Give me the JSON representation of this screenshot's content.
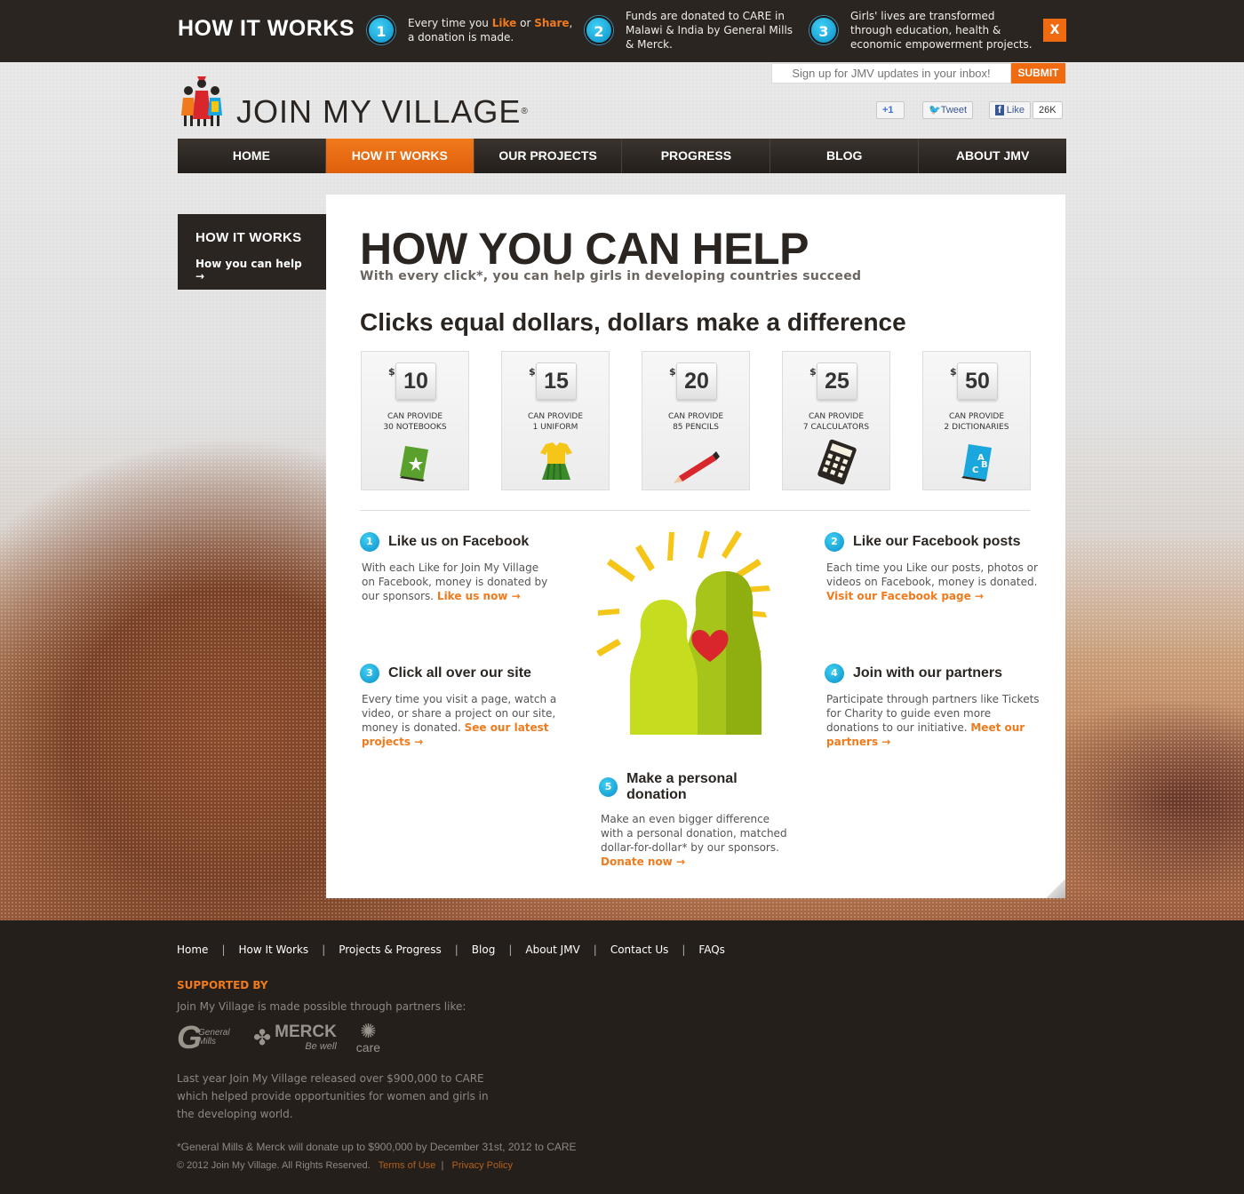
{
  "topbar": {
    "title": "HOW IT WORKS",
    "steps": [
      {
        "num": "1",
        "text_a": "Every time you ",
        "like": "Like",
        "text_b": " or ",
        "share": "Share",
        "text_c": ", a donation is made."
      },
      {
        "num": "2",
        "text": "Funds are donated to CARE in Malawi & India by General Mills & Merck."
      },
      {
        "num": "3",
        "text": "Girls' lives are transformed through education, health & economic empowerment projects."
      }
    ],
    "close_label": "X"
  },
  "header": {
    "signup_placeholder": "Sign up for JMV updates in your inbox!",
    "submit_label": "SUBMIT",
    "logo_text": "JOIN MY VILLAGE",
    "logo_reg": "®",
    "plusone": "+1",
    "tweet": "Tweet",
    "like": "Like",
    "like_count": "26K"
  },
  "nav": [
    "HOME",
    "HOW IT WORKS",
    "OUR PROJECTS",
    "PROGRESS",
    "BLOG",
    "ABOUT JMV"
  ],
  "sidebar": {
    "heading": "HOW IT WORKS",
    "link": "How you can help →"
  },
  "main": {
    "title": "HOW YOU CAN HELP",
    "subtitle": "With every click*, you can help girls in developing countries succeed",
    "heading2": "Clicks equal dollars, dollars make a difference",
    "cards": [
      {
        "dollar": "$",
        "amount": "10",
        "line1": "CAN PROVIDE",
        "line2": "30 NOTEBOOKS",
        "icon": "notebook-icon"
      },
      {
        "dollar": "$",
        "amount": "15",
        "line1": "CAN PROVIDE",
        "line2": "1 UNIFORM",
        "icon": "uniform-icon"
      },
      {
        "dollar": "$",
        "amount": "20",
        "line1": "CAN PROVIDE",
        "line2": "85 PENCILS",
        "icon": "pencil-icon"
      },
      {
        "dollar": "$",
        "amount": "25",
        "line1": "CAN PROVIDE",
        "line2": "7 CALCULATORS",
        "icon": "calculator-icon"
      },
      {
        "dollar": "$",
        "amount": "50",
        "line1": "CAN PROVIDE",
        "line2": "2 DICTIONARIES",
        "icon": "dictionary-icon"
      }
    ],
    "features": [
      {
        "num": "1",
        "title": "Like us on Facebook",
        "body": "With each Like for Join My Village on Facebook, money is donated by our sponsors. ",
        "link": "Like us now →"
      },
      {
        "num": "2",
        "title": "Like our Facebook posts",
        "body": "Each time you Like our posts, photos or videos on Facebook, money is donated. ",
        "link": "Visit our Facebook page →"
      },
      {
        "num": "3",
        "title": "Click all over our site",
        "body": "Every time you visit a page, watch a video, or share a project on our site, money is donated. ",
        "link": "See our latest projects →"
      },
      {
        "num": "4",
        "title": "Join with our partners",
        "body": "Participate through partners like Tickets for Charity to guide even more donations to our initiative. ",
        "link": "Meet our partners →"
      },
      {
        "num": "5",
        "title": "Make a personal donation",
        "body": "Make an even bigger difference with a personal donation, matched dollar-for-dollar* by our sponsors. ",
        "link": "Donate now →"
      }
    ]
  },
  "footer": {
    "nav": [
      "Home",
      "How It Works",
      "Projects & Progress",
      "Blog",
      "About JMV",
      "Contact Us",
      "FAQs"
    ],
    "supported_by": "SUPPORTED BY",
    "supported_desc": "Join My Village is made possible through partners like:",
    "partners": [
      "General Mills",
      "MERCK",
      "Be well",
      "care"
    ],
    "released": "Last year Join My Village released over $900,000 to CARE which helped provide opportunities for women and girls in the developing world.",
    "disclaimer": "*General Mills & Merck will donate up to $900,000 by December 31st, 2012 to CARE",
    "copyright": "© 2012 Join My Village.  All Rights Reserved.",
    "terms": "Terms of Use",
    "privacy": "Privacy Policy"
  },
  "colors": {
    "accent": "#f07a1c",
    "dark": "#2b2521",
    "blue": "#1aa7dd",
    "green": "#a6c41a"
  }
}
